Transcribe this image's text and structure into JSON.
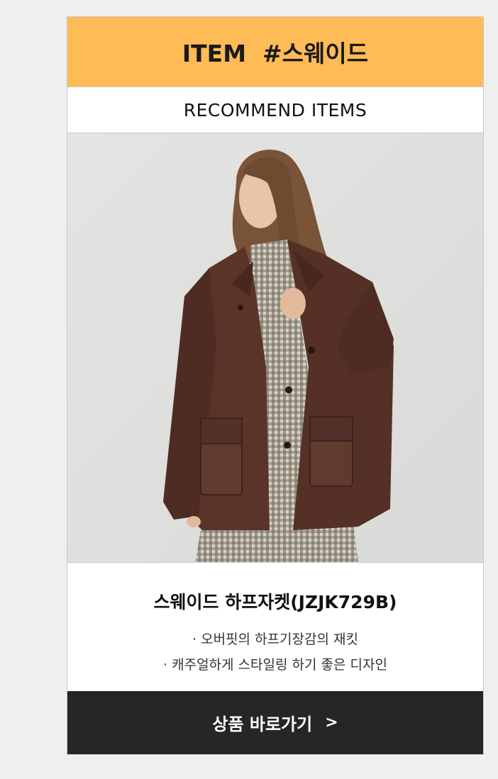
{
  "banner": {
    "title": "ITEM  #스웨이드"
  },
  "section": {
    "title": "RECOMMEND ITEMS"
  },
  "product": {
    "image_alt": "스웨이드 하프자켓(JZJK729B)",
    "name": "스웨이드 하프자켓(JZJK729B)",
    "features": [
      "· 오버핏의 하프기장감의 재킷",
      "· 캐주얼하게 스타일링 하기 좋은 디자인"
    ]
  },
  "cta": {
    "label": "상품 바로가기",
    "arrow": ">"
  },
  "colors": {
    "banner": "#ffbb55",
    "cta_background": "#262626",
    "photo_background": "#e2e2e0",
    "jacket": "#5a3329"
  }
}
